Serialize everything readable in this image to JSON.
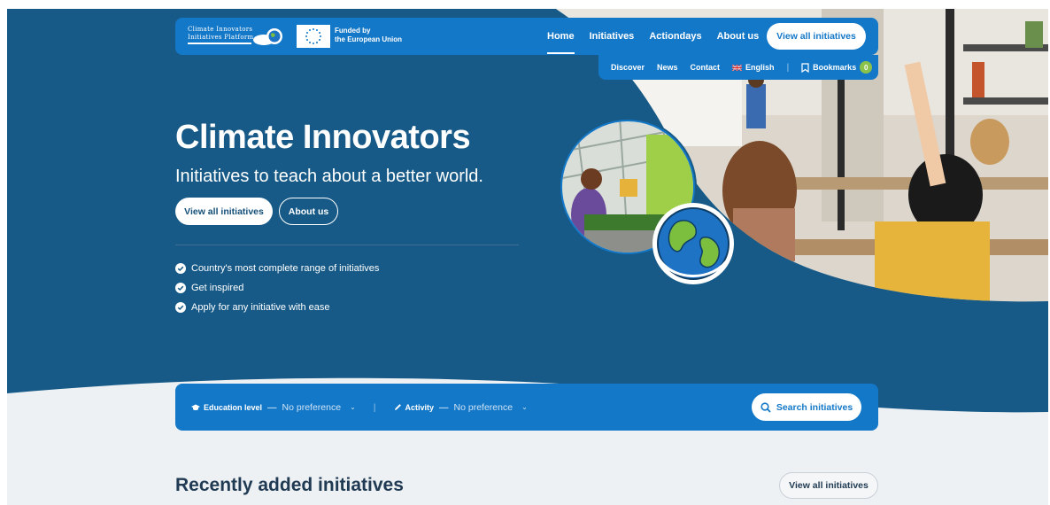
{
  "brand": {
    "logo_line1": "Climate Innovators",
    "logo_line2": "Initiatives Platform",
    "eu_line1": "Funded by",
    "eu_line2": "the European Union"
  },
  "nav": {
    "items": [
      "Home",
      "Initiatives",
      "Actiondays",
      "About us"
    ],
    "active": "Home",
    "cta": "View all initiatives"
  },
  "subnav": {
    "discover": "Discover",
    "news": "News",
    "contact": "Contact",
    "language": "English",
    "bookmarks": "Bookmarks",
    "bookmark_count": "0"
  },
  "hero": {
    "title": "Climate Innovators",
    "tagline": "Initiatives to teach about a better world.",
    "primary_button": "View all initiatives",
    "secondary_button": "About us",
    "features": [
      "Country's most complete range of initiatives",
      "Get inspired",
      "Apply for any initiative with ease"
    ]
  },
  "filters": {
    "education_label": "Education level",
    "education_value": "No preference",
    "activity_label": "Activity",
    "activity_value": "No preference",
    "search_button": "Search initiatives"
  },
  "recent": {
    "title": "Recently added initiatives",
    "button": "View all initiatives"
  },
  "colors": {
    "hero_navy": "#175a87",
    "bar_blue": "#1478c8",
    "page_bg": "#eef1f4",
    "accent_green": "#8bc34a"
  }
}
